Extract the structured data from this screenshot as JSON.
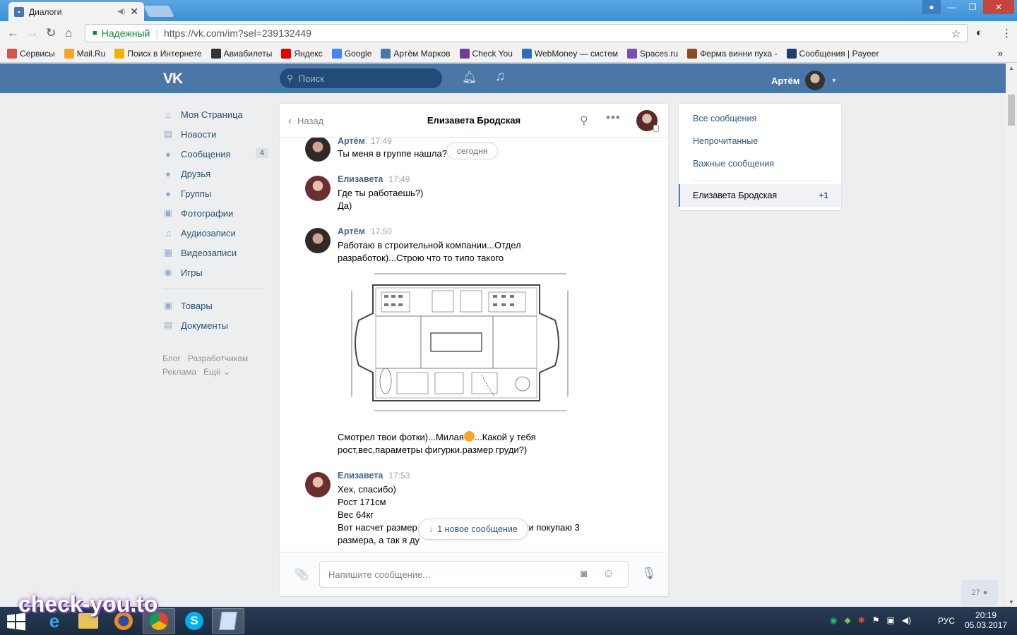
{
  "browser": {
    "tab_title": "Диалоги",
    "secure_label": "Надежный",
    "url": "https://vk.com/im?sel=239132449",
    "bookmarks": [
      {
        "label": "Сервисы",
        "color": "#d9534f"
      },
      {
        "label": "Mail.Ru",
        "color": "#f5a623"
      },
      {
        "label": "Поиск в Интернете",
        "color": "#f0b400"
      },
      {
        "label": "Авиабилеты",
        "color": "#333333"
      },
      {
        "label": "Яндекс",
        "color": "#e00000"
      },
      {
        "label": "Google",
        "color": "#4285f4"
      },
      {
        "label": "Артём Марков",
        "color": "#4a76a8"
      },
      {
        "label": "Check You",
        "color": "#6b3f9a"
      },
      {
        "label": "WebMoney — систем",
        "color": "#2f6fb5"
      },
      {
        "label": "Spaces.ru",
        "color": "#7a4fb0"
      },
      {
        "label": "Ферма винни пуха -",
        "color": "#8a4b1f"
      },
      {
        "label": "Сообщения | Payeer",
        "color": "#1f3f6e"
      }
    ]
  },
  "vk": {
    "search_placeholder": "Поиск",
    "user_name": "Артём",
    "nav": [
      {
        "label": "Моя Страница",
        "icon": "home-icon",
        "glyph": "⌂"
      },
      {
        "label": "Новости",
        "icon": "news-icon",
        "glyph": "▤"
      },
      {
        "label": "Сообщения",
        "icon": "messages-icon",
        "glyph": "●",
        "count": "4"
      },
      {
        "label": "Друзья",
        "icon": "friends-icon",
        "glyph": "●"
      },
      {
        "label": "Группы",
        "icon": "groups-icon",
        "glyph": "●"
      },
      {
        "label": "Фотографии",
        "icon": "photos-icon",
        "glyph": "▣"
      },
      {
        "label": "Аудиозаписи",
        "icon": "audio-icon",
        "glyph": "♫"
      },
      {
        "label": "Видеозаписи",
        "icon": "video-icon",
        "glyph": "▦"
      },
      {
        "label": "Игры",
        "icon": "games-icon",
        "glyph": "◉"
      }
    ],
    "nav2": [
      {
        "label": "Товары",
        "icon": "goods-icon",
        "glyph": "▣"
      },
      {
        "label": "Документы",
        "icon": "documents-icon",
        "glyph": "▤"
      }
    ],
    "footer": [
      "Блог",
      "Разработчикам",
      "Реклама",
      "Ещё ⌄"
    ]
  },
  "chat": {
    "back_label": "Назад",
    "title": "Елизавета Бродская",
    "today_label": "сегодня",
    "new_message_label": "1 новое сообщение",
    "composer_placeholder": "Напишите сообщение...",
    "messages": [
      {
        "author": "Артём",
        "time": "17:49",
        "lines": [
          "Ты меня в группе нашла?"
        ]
      },
      {
        "author": "Елизавета",
        "time": "17:49",
        "lines": [
          "Где ты работаешь?)",
          "Да)"
        ]
      },
      {
        "author": "Артём",
        "time": "17:50",
        "lines": [
          "Работаю в строительной компании...Отдел",
          "разработок)...Строю что то типо такого"
        ]
      },
      {
        "author": "Артём",
        "time": "",
        "lines": [
          "Смотрел твои фотки)...Милая",
          "...Какой у тебя",
          "рост,вес,параметры фигурки.размер груди?)"
        ]
      },
      {
        "author": "Елизавета",
        "time": "17:53",
        "lines": [
          "Хех, спасибо)",
          "Рост 171см",
          "Вес 64кг",
          "Вот насчет размер",
          "ички покупаю 3",
          "размера, а так я ду"
        ]
      }
    ]
  },
  "right_panel": {
    "all": "Все сообщения",
    "unread": "Непрочитанные",
    "important": "Важные сообщения",
    "active_dialog": "Елизавета Бродская",
    "active_count": "+1"
  },
  "online_count": "27",
  "taskbar": {
    "lang": "РУС",
    "time": "20:19",
    "date": "05.03.2017"
  },
  "watermark": "check-you.to"
}
